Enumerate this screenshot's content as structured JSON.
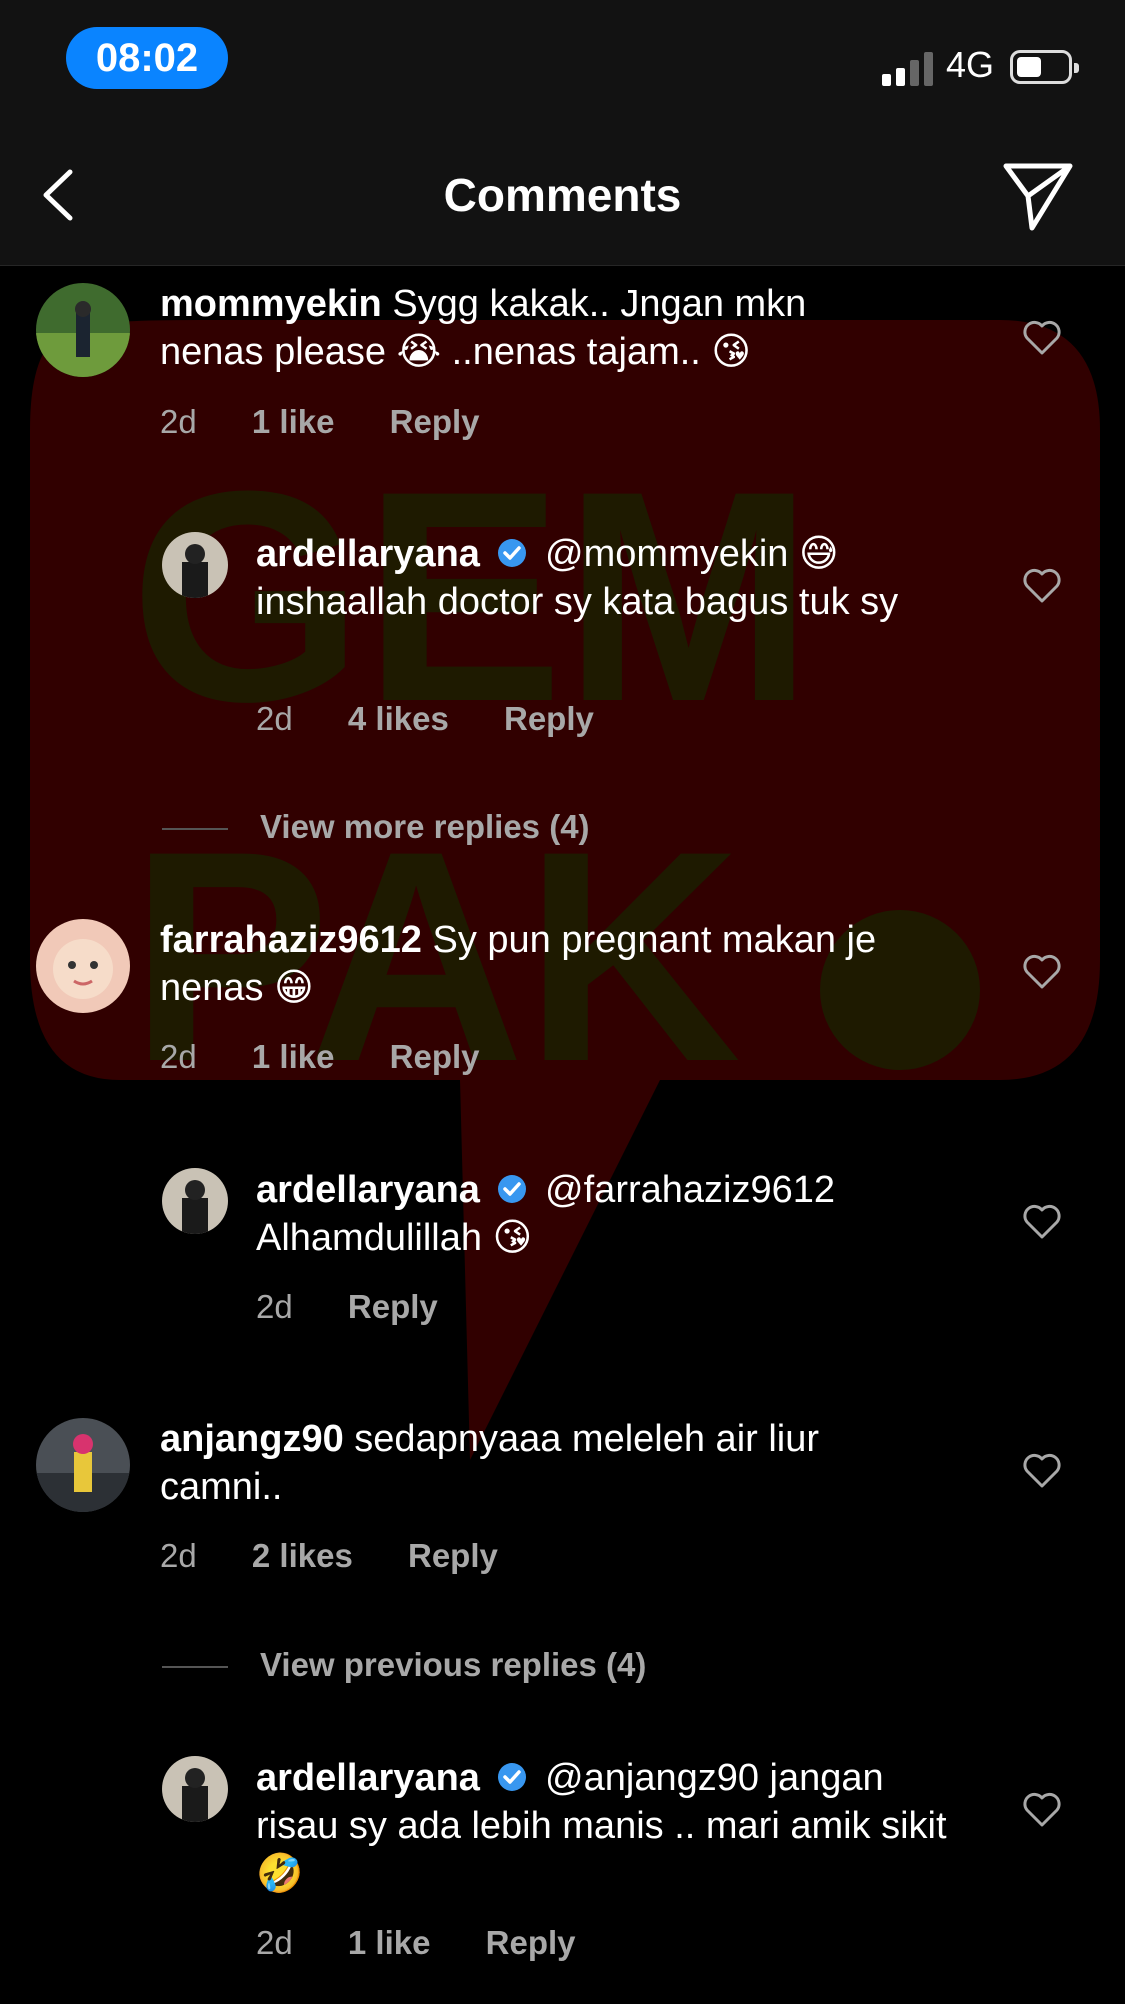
{
  "status": {
    "time": "08:02",
    "network": "4G"
  },
  "header": {
    "title": "Comments"
  },
  "comments": [
    {
      "user": "mommyekin",
      "text": "Sygg kakak.. Jngan mkn nenas please 😭 ..nenas tajam.. 😘",
      "age": "2d",
      "likes": "1 like",
      "reply": "Reply"
    },
    {
      "user": "ardellaryana",
      "text": "@mommyekin 😅 inshaallah doctor sy kata bagus tuk sy",
      "age": "2d",
      "likes": "4 likes",
      "reply": "Reply"
    },
    {
      "user": "farrahaziz9612",
      "text": "Sy pun pregnant makan je nenas 😁",
      "age": "2d",
      "likes": "1 like",
      "reply": "Reply"
    },
    {
      "user": "ardellaryana",
      "text": "@farrahaziz9612 Alhamdulillah 😘",
      "age": "2d",
      "likes": "",
      "reply": "Reply"
    },
    {
      "user": "anjangz90",
      "text": "sedapnyaaa meleleh air liur camni..",
      "age": "2d",
      "likes": "2 likes",
      "reply": "Reply"
    },
    {
      "user": "ardellaryana",
      "text": "@anjangz90 jangan risau sy ada lebih manis .. mari amik sikit 🤣",
      "age": "2d",
      "likes": "1 like",
      "reply": "Reply"
    }
  ],
  "view_more": "View more replies (4)",
  "view_previous": "View previous replies (4)",
  "watermark": {
    "line1": "GEM",
    "line2": "PAK"
  },
  "colors": {
    "accent": "#0a84ff",
    "verified": "#3897f0",
    "muted": "#a8a8a8",
    "watermark": "#5a0000"
  }
}
